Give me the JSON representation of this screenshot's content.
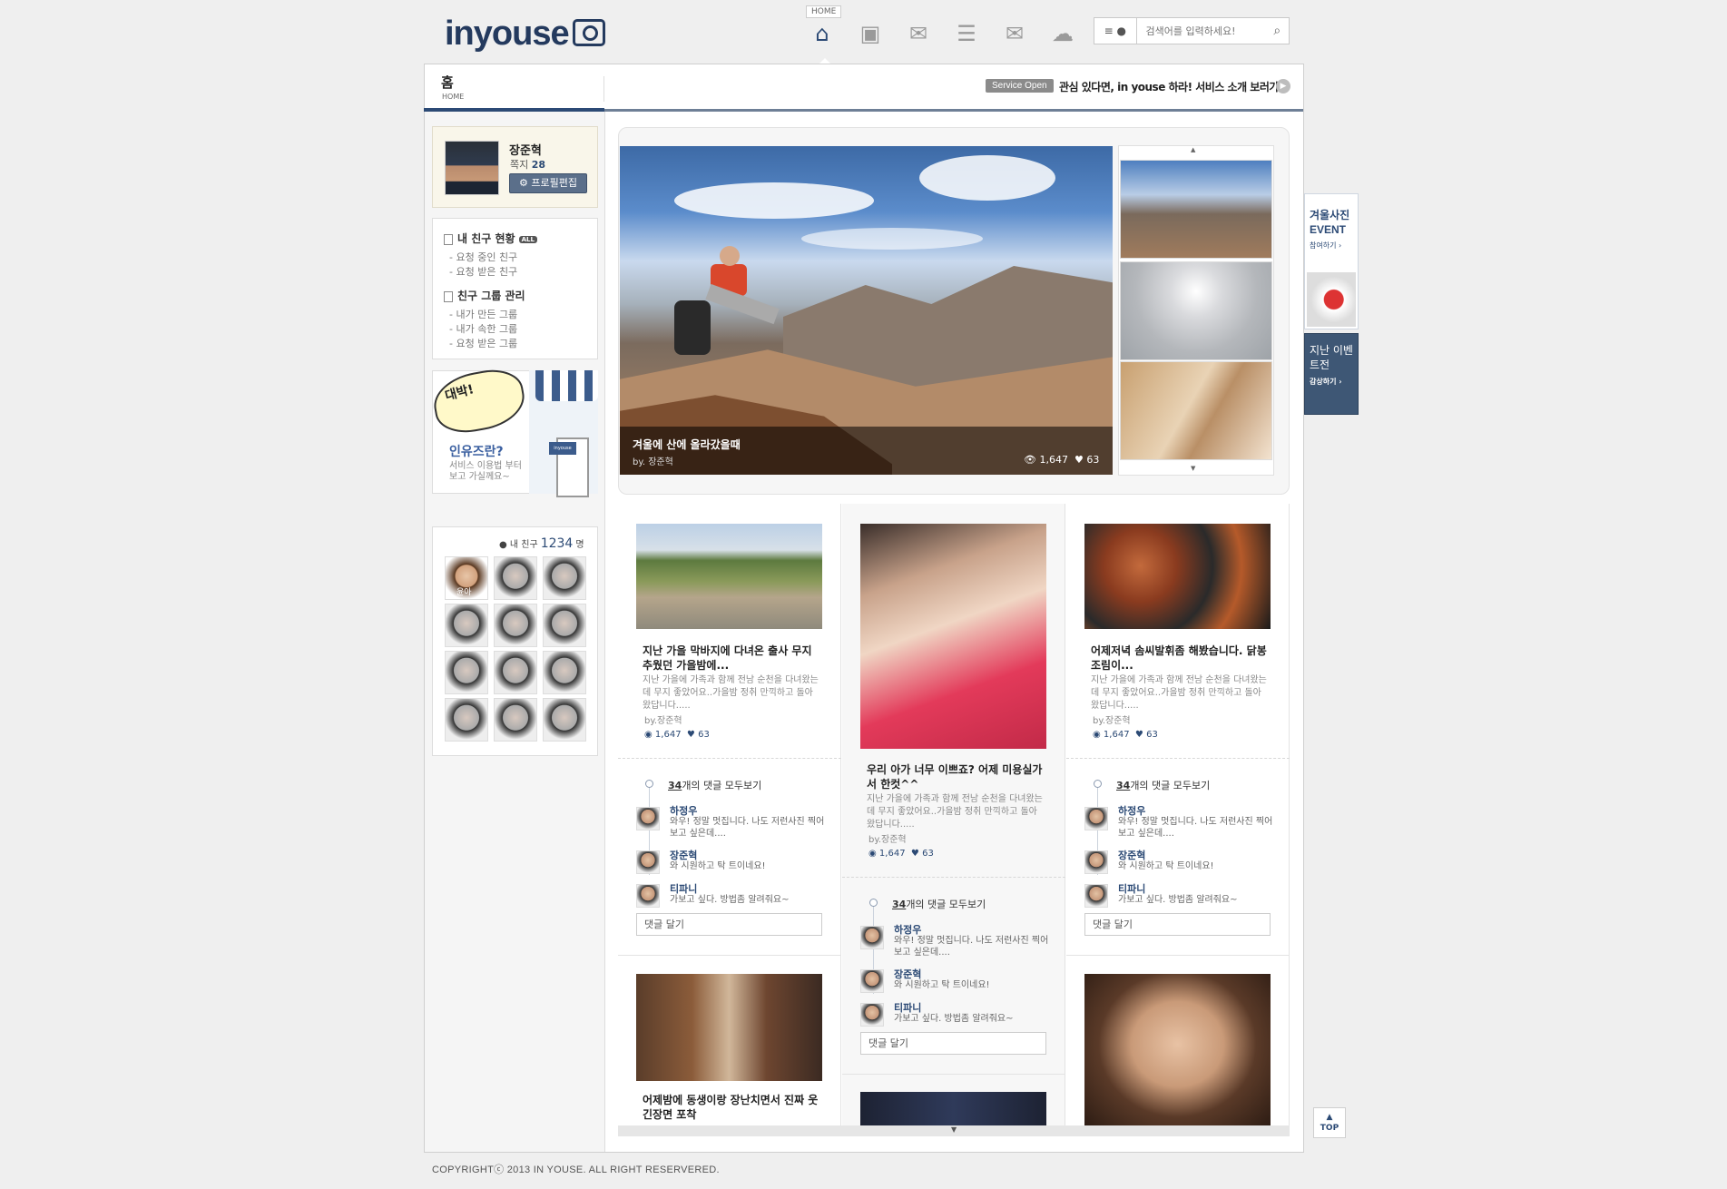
{
  "header": {
    "logo": "inyouse",
    "home_tag": "HOME",
    "nav": [
      {
        "icon": "home-icon",
        "glyph": "⌂"
      },
      {
        "icon": "save-icon",
        "glyph": "🖫"
      },
      {
        "icon": "photos-icon",
        "glyph": "✉"
      },
      {
        "icon": "contacts-icon",
        "glyph": "☰"
      },
      {
        "icon": "mail-icon",
        "glyph": "✉"
      },
      {
        "icon": "chat-icon",
        "glyph": "💬"
      }
    ],
    "search_placeholder": "검색어를 입력하세요!"
  },
  "crumb": {
    "title_ko": "홈",
    "title_en": "HOME"
  },
  "service": {
    "badge": "Service Open",
    "text": "관심 있다면, in youse 하라! 서비스 소개 보러가기"
  },
  "profile": {
    "name": "장준혁",
    "msg_label": "쪽지",
    "msg_count": "28",
    "edit_label": "프로필편집"
  },
  "friend_menu": {
    "status_title": "내 친구 현황",
    "all_badge": "ALL",
    "status_items": [
      "요청 중인 친구",
      "요청 받은 친구"
    ],
    "group_title": "친구 그룹 관리",
    "group_items": [
      "내가 만든 그룹",
      "내가 속한 그룹",
      "요청 받은 그룹"
    ]
  },
  "banner": {
    "bubble": "대박!",
    "title": "인유즈란?",
    "sub_line1": "서비스 이용법 부터",
    "sub_line2": "보고 가실께요~",
    "sign": "inyouse"
  },
  "my_friends": {
    "label": "내 친구",
    "count": "1234",
    "unit": "명",
    "first_name": "윤아"
  },
  "slider": {
    "title": "겨울에 산에 올라갔을때",
    "by": "by. 장준혁",
    "views": "1,647",
    "likes": "63"
  },
  "cards": [
    {
      "title": "지난 가을 막바지에 다녀온 출사 무지 추웠던 가을밤에...",
      "desc": "지난 가을에 가족과 함께 전남 순천을 다녀왔는데 무지 좋았어요..가을밤 정취 만끽하고 돌아왔답니다.....",
      "by": "by.장준혁",
      "views": "1,647",
      "likes": "63"
    },
    {
      "title": "우리 아가 너무 이쁘죠? 어제 미용실가서 한컷^^",
      "desc": "지난 가을에 가족과 함께 전남 순천을 다녀왔는데 무지 좋았어요..가을밤 정취 만끽하고 돌아왔답니다.....",
      "by": "by.장준혁",
      "views": "1,647",
      "likes": "63"
    },
    {
      "title": "어제저녁 솜씨발휘좀 해봤습니다. 닭봉 조림이...",
      "desc": "지난 가을에 가족과 함께 전남 순천을 다녀왔는데 무지 좋았어요..가을밤 정취 만끽하고 돌아왔답니다.....",
      "by": "by.장준혁",
      "views": "1,647",
      "likes": "63"
    },
    {
      "title": "어제밤에 동생이랑 장난치면서 진짜 웃긴장면 포착"
    }
  ],
  "comments": {
    "count": "34",
    "suffix": "개의 댓글 모두보기",
    "items": [
      {
        "name": "하정우",
        "text": "와우! 정말 멋집니다. 나도 저런사진 찍어보고 싶은데...."
      },
      {
        "name": "장준혁",
        "text": "와 시원하고 탁 트이네요!"
      },
      {
        "name": "티파니",
        "text": "가보고 싶다. 방법좀 알려줘요~"
      }
    ],
    "input_placeholder": "댓글 달기"
  },
  "events": {
    "ev1_title": "겨울사진 EVENT",
    "ev1_sub": "참여하기 ›",
    "ev2_title": "지난 이벤트전",
    "ev2_sub": "감상하기 ›"
  },
  "top_button": "TOP",
  "footer": "COPYRIGHTⓒ 2013 IN YOUSE. ALL RIGHT RESERVERED."
}
